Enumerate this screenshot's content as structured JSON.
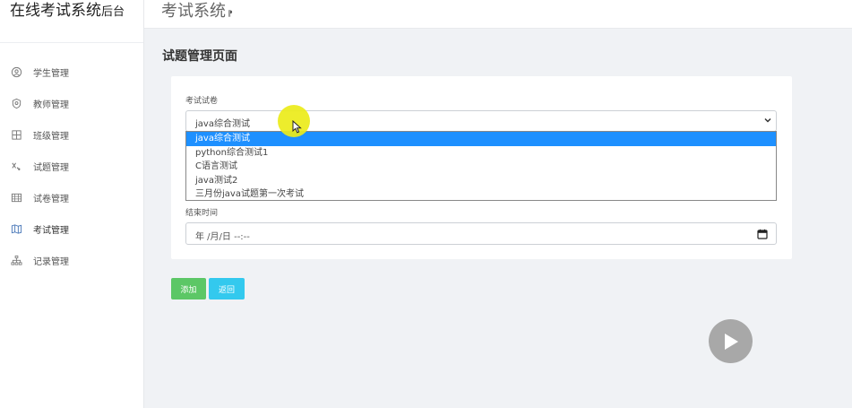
{
  "brand": {
    "title": "在线考试系统",
    "subtitle": "后台"
  },
  "topbar": {
    "title": "考试系统",
    "glyph": "⁋"
  },
  "sidebar": {
    "items": [
      {
        "label": "学生管理",
        "icon": "user-circle-icon"
      },
      {
        "label": "教师管理",
        "icon": "badge-icon"
      },
      {
        "label": "班级管理",
        "icon": "grid-icon"
      },
      {
        "label": "试题管理",
        "icon": "formula-icon"
      },
      {
        "label": "试卷管理",
        "icon": "table-icon"
      },
      {
        "label": "考试管理",
        "icon": "map-icon",
        "active": true
      },
      {
        "label": "记录管理",
        "icon": "sitemap-icon"
      }
    ]
  },
  "page": {
    "title": "试题管理页面"
  },
  "form": {
    "paper_label": "考试试卷",
    "paper_selected": "java综合测试",
    "paper_options": [
      "java综合测试",
      "python综合测试1",
      "C语言测试",
      "java测试2",
      "三月份java试题第一次考试"
    ],
    "end_time_label": "结束时间",
    "end_time_value": "年 /月/日  --:--"
  },
  "buttons": {
    "add": "添加",
    "back": "返回"
  },
  "colors": {
    "selected_option": "#1e90ff",
    "add_button": "#5cc766",
    "back_button": "#33c9ee",
    "cursor_highlight": "#ecec1a"
  }
}
